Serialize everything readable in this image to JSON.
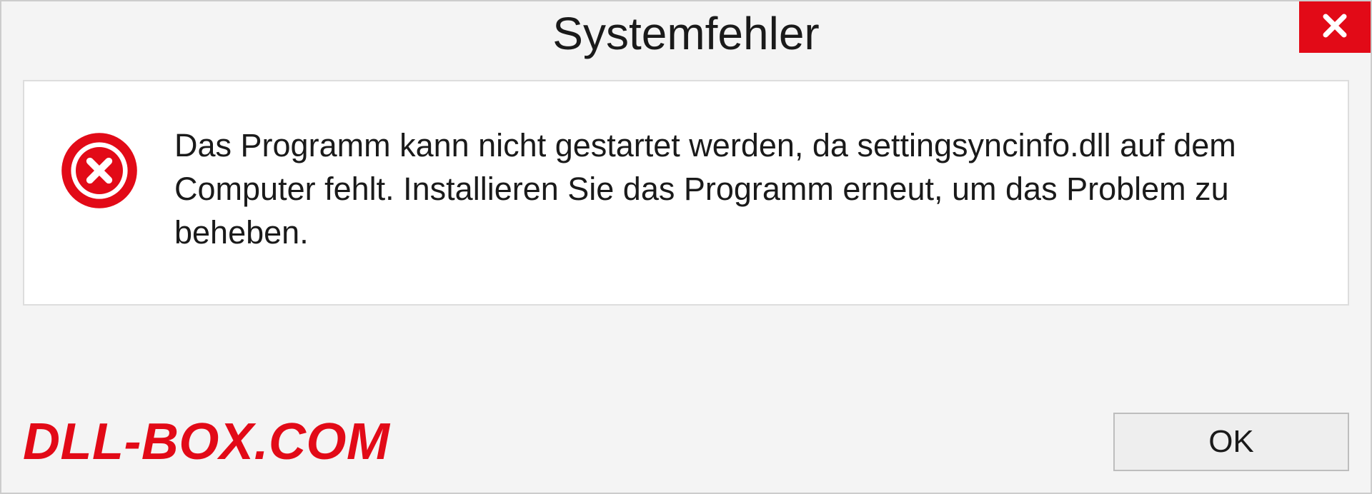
{
  "dialog": {
    "title": "Systemfehler",
    "message": "Das Programm kann nicht gestartet werden, da settingsyncinfo.dll auf dem Computer fehlt. Installieren Sie das Programm erneut, um das Problem zu beheben.",
    "ok_label": "OK"
  },
  "watermark": "DLL-BOX.COM",
  "colors": {
    "accent_red": "#e20a17",
    "panel_bg": "#f4f4f4",
    "content_bg": "#ffffff"
  }
}
